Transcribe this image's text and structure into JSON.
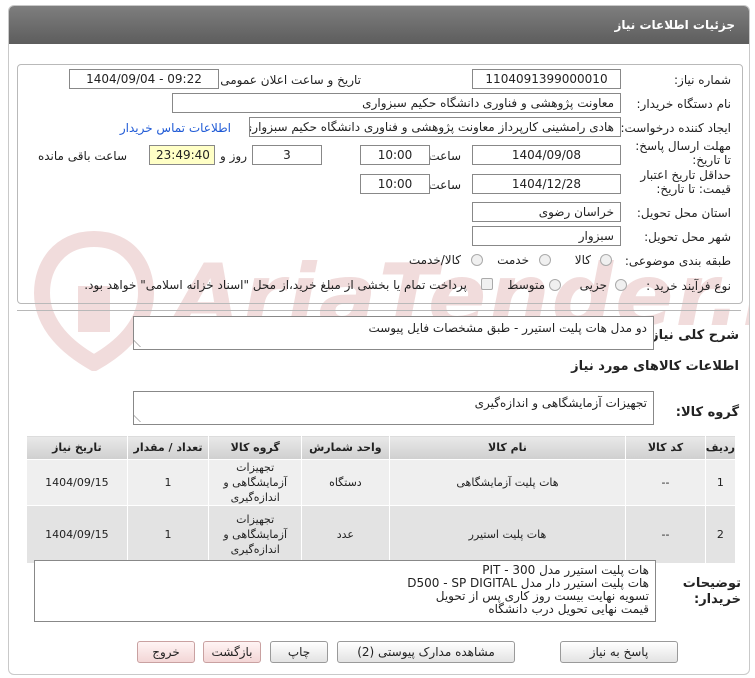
{
  "header": {
    "title": "جزئیات اطلاعات نیاز"
  },
  "form": {
    "need_number_label": "شماره نیاز:",
    "need_number": "1104091399000010",
    "announce_label": "تاریخ و ساعت اعلان عمومی:",
    "announce_value": "1404/09/04 - 09:22",
    "buyer_org_label": "نام دستگاه خریدار:",
    "buyer_org": "معاونت پژوهشی و فناوری دانشگاه حکیم سبزواری",
    "creator_label": "ایجاد کننده درخواست:",
    "creator": "هادی رامشینی کارپرداز معاونت پژوهشی و فناوری دانشگاه حکیم سبزواری",
    "contact_link": "اطلاعات تماس خریدار",
    "deadline_label": "مهلت ارسال پاسخ: تا تاریخ:",
    "deadline_date": "1404/09/08",
    "time_label": "ساعت",
    "deadline_time": "10:00",
    "days_value": "3",
    "days_label": "روز و",
    "remaining_time": "23:49:40",
    "remaining_label": "ساعت باقی مانده",
    "validity_label": "حداقل تاریخ اعتبار قیمت: تا تاریخ:",
    "validity_date": "1404/12/28",
    "validity_time": "10:00",
    "province_label": "استان محل تحویل:",
    "province": "خراسان رضوی",
    "city_label": "شهر محل تحویل:",
    "city": "سبزوار",
    "category_label": "طبقه بندی موضوعی:",
    "category_options": [
      "کالا",
      "خدمت",
      "کالا/خدمت"
    ],
    "process_label": "نوع فرآیند خرید :",
    "process_options": [
      "جزیی",
      "متوسط"
    ],
    "payment_note": "پرداخت تمام یا بخشی از مبلغ خرید،از محل \"اسناد خزانه اسلامی\" خواهد بود."
  },
  "description": {
    "label": "شرح کلی نیاز:",
    "text": "دو مدل هات پلیت استیرر - طبق مشخصات فایل پیوست"
  },
  "goods": {
    "section_title": "اطلاعات کالاهای مورد نیاز",
    "group_label": "گروه کالا:",
    "group_value": "تجهیزات آزمایشگاهی و اندازه‌گیری",
    "columns": [
      "ردیف",
      "کد کالا",
      "نام کالا",
      "واحد شمارش",
      "گروه کالا",
      "تعداد / مقدار",
      "تاریخ نیاز"
    ],
    "rows": [
      {
        "index": "1",
        "code": "--",
        "name": "هات پلیت آزمایشگاهی",
        "unit": "دستگاه",
        "group": "تجهیزات آزمایشگاهی و اندازه‌گیری",
        "qty": "1",
        "date": "1404/09/15"
      },
      {
        "index": "2",
        "code": "--",
        "name": "هات پلیت استیرر",
        "unit": "عدد",
        "group": "تجهیزات آزمایشگاهی و اندازه‌گیری",
        "qty": "1",
        "date": "1404/09/15"
      }
    ]
  },
  "buyer_notes": {
    "label": "توضیحات خریدار:",
    "lines": [
      "هات پلیت استیرر مدل PIT - 300",
      "هات پلیت استیرر دار مدل  D500 - SP DIGITAL",
      "تسویه نهایت بیست روز کاری پس از تحویل",
      "قیمت نهایی تحویل درب دانشگاه"
    ]
  },
  "buttons": {
    "reply": "پاسخ به نیاز",
    "attachments": "مشاهده مدارک پیوستی (2)",
    "print": "چاپ",
    "back": "بازگشت",
    "exit": "خروج"
  },
  "watermark": {
    "text": "AriaTender.neT"
  }
}
